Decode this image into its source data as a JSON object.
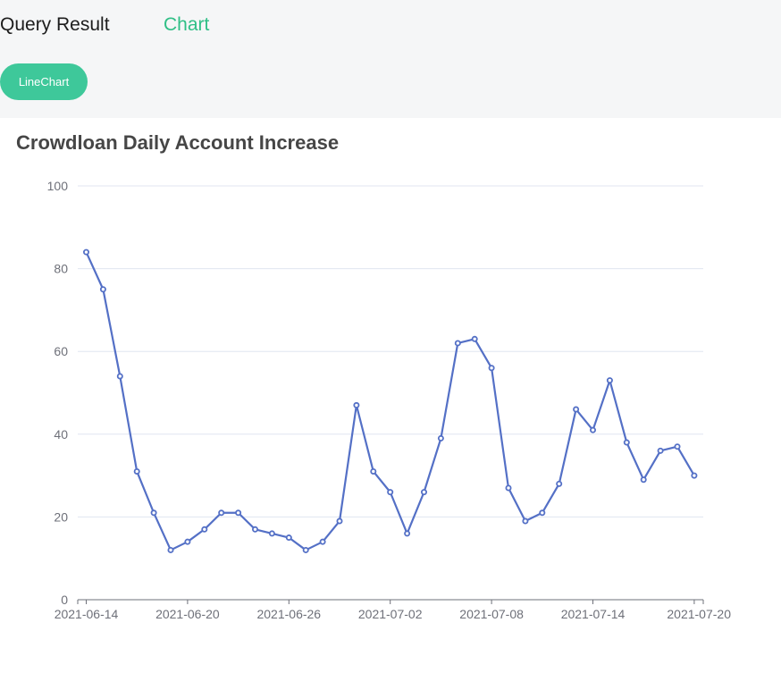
{
  "tabs": [
    {
      "label": "Query Result",
      "active": false
    },
    {
      "label": "Chart",
      "active": true
    }
  ],
  "chart_type_button": {
    "label": "LineChart"
  },
  "colors": {
    "accent_text": "#2fbf86",
    "pill_bg": "#3ec89a",
    "series_line": "#5470c6",
    "grid": "#e0e6f1",
    "axis": "#6e7079"
  },
  "chart_data": {
    "type": "line",
    "title": "Crowdloan Daily Account Increase",
    "xlabel": "",
    "ylabel": "",
    "ylim": [
      0,
      100
    ],
    "y_ticks": [
      0,
      20,
      40,
      60,
      80,
      100
    ],
    "x_tick_labels": [
      "2021-06-14",
      "2021-06-20",
      "2021-06-26",
      "2021-07-02",
      "2021-07-08",
      "2021-07-14",
      "2021-07-20"
    ],
    "x": [
      "2021-06-14",
      "2021-06-15",
      "2021-06-16",
      "2021-06-17",
      "2021-06-18",
      "2021-06-19",
      "2021-06-20",
      "2021-06-21",
      "2021-06-22",
      "2021-06-23",
      "2021-06-24",
      "2021-06-25",
      "2021-06-26",
      "2021-06-27",
      "2021-06-28",
      "2021-06-29",
      "2021-06-30",
      "2021-07-01",
      "2021-07-02",
      "2021-07-03",
      "2021-07-04",
      "2021-07-05",
      "2021-07-06",
      "2021-07-07",
      "2021-07-08",
      "2021-07-09",
      "2021-07-10",
      "2021-07-11",
      "2021-07-12",
      "2021-07-13",
      "2021-07-14",
      "2021-07-15",
      "2021-07-16",
      "2021-07-17",
      "2021-07-18",
      "2021-07-19",
      "2021-07-20"
    ],
    "series": [
      {
        "values": [
          84,
          75,
          54,
          31,
          21,
          12,
          14,
          17,
          21,
          21,
          17,
          16,
          15,
          12,
          14,
          19,
          47,
          31,
          26,
          16,
          26,
          39,
          62,
          63,
          56,
          27,
          19,
          21,
          28,
          46,
          41,
          53,
          38,
          29,
          36,
          37,
          30
        ]
      }
    ],
    "grid": true,
    "legend": "none"
  }
}
